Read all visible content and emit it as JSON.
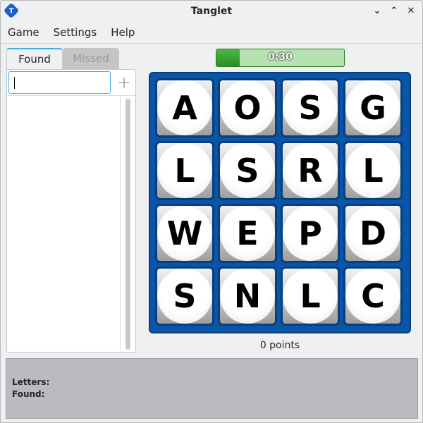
{
  "window": {
    "title": "Tanglet"
  },
  "menu": [
    "Game",
    "Settings",
    "Help"
  ],
  "tabs": [
    {
      "label": "Found"
    },
    {
      "label": "Missed"
    }
  ],
  "word_input": {
    "value": "",
    "add_symbol": "+"
  },
  "timer": {
    "text": "0:30",
    "progress": 0.18
  },
  "board": {
    "letters": [
      "A",
      "O",
      "S",
      "G",
      "L",
      "S",
      "R",
      "L",
      "W",
      "E",
      "P",
      "D",
      "S",
      "N",
      "L",
      "C"
    ]
  },
  "score": {
    "text": "0 points"
  },
  "status": {
    "letters_label": "Letters:",
    "found_label": "Found:"
  },
  "colors": {
    "board": "#0a55a8",
    "timer": "#2c8e26",
    "accent": "#3daee9"
  }
}
